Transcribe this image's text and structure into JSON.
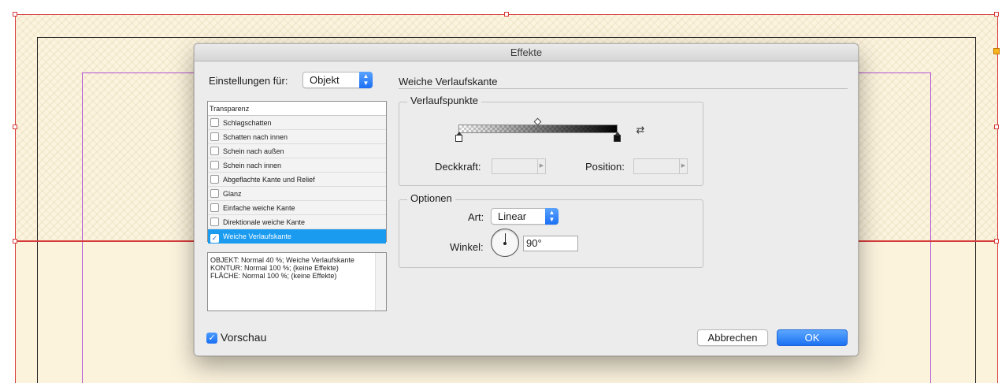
{
  "dialog": {
    "title": "Effekte",
    "settings_for": {
      "label": "Einstellungen für:",
      "selected": "Objekt"
    },
    "section_title": "Weiche Verlaufskante",
    "effects": {
      "header": "Transparenz",
      "items": [
        {
          "label": "Schlagschatten",
          "checked": false
        },
        {
          "label": "Schatten nach innen",
          "checked": false
        },
        {
          "label": "Schein nach außen",
          "checked": false
        },
        {
          "label": "Schein nach innen",
          "checked": false
        },
        {
          "label": "Abgeflachte Kante und Relief",
          "checked": false
        },
        {
          "label": "Glanz",
          "checked": false
        },
        {
          "label": "Einfache weiche Kante",
          "checked": false
        },
        {
          "label": "Direktionale weiche Kante",
          "checked": false
        },
        {
          "label": "Weiche Verlaufskante",
          "checked": true
        }
      ]
    },
    "summary": [
      "OBJEKT: Normal 40 %; Weiche Verlaufskante",
      "KONTUR: Normal 100 %; (keine Effekte)",
      "FLÄCHE: Normal 100 %; (keine Effekte)"
    ],
    "gradient_stops": {
      "legend": "Verlaufspunkte",
      "opacity_label": "Deckkraft:",
      "opacity_value": "",
      "position_label": "Position:",
      "position_value": "",
      "reverse_icon": "reverse-gradient-icon",
      "midpoint_fraction": 0.5
    },
    "options": {
      "legend": "Optionen",
      "type_label": "Art:",
      "type_value": "Linear",
      "angle_label": "Winkel:",
      "angle_value": "90°"
    },
    "preview": {
      "label": "Vorschau",
      "checked": true
    },
    "buttons": {
      "cancel": "Abbrechen",
      "ok": "OK"
    }
  },
  "colors": {
    "accent": "#1a9bf0",
    "ok_button": "#1d72f3",
    "frame_red": "#d63b3b",
    "frame_purple": "#b052d4",
    "page_fill": "#fcf4de"
  }
}
